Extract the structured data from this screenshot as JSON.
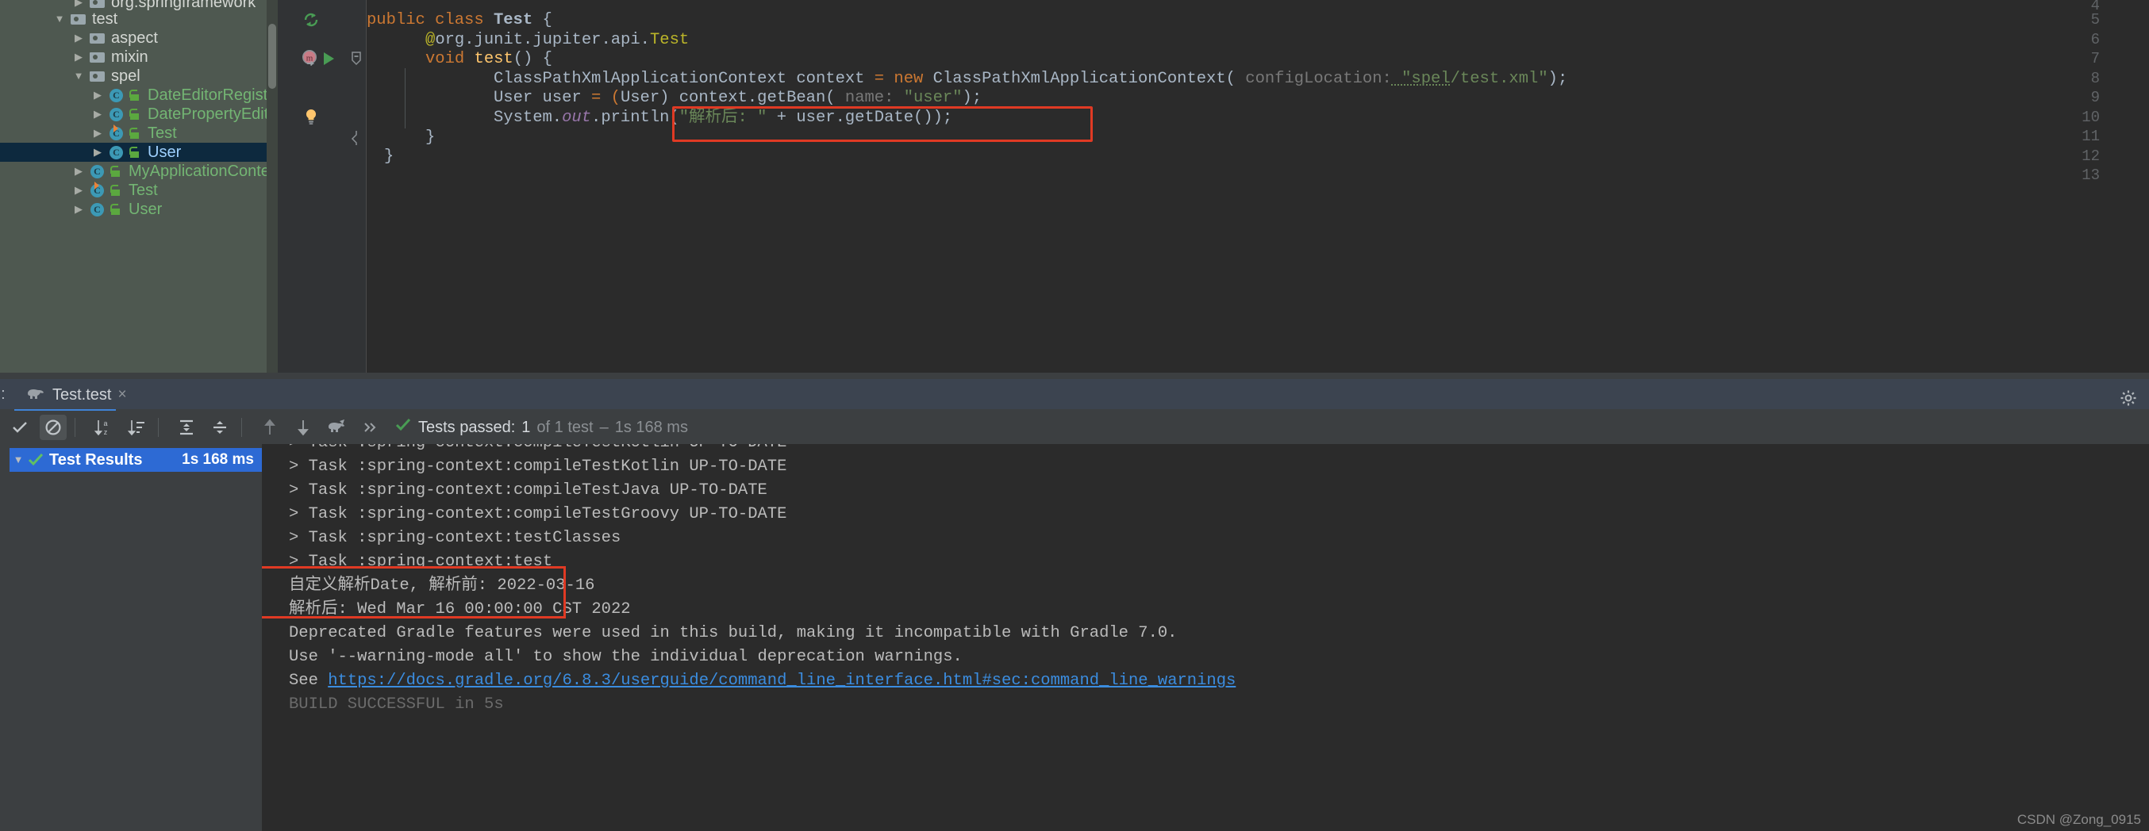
{
  "project_tree": {
    "items": [
      {
        "indent": 1,
        "arrow": "collapsed",
        "icon": "folder-icon",
        "label": "org.springframework",
        "kind": "pkg",
        "clipped_top": true
      },
      {
        "indent": 1,
        "arrow": "expanded",
        "icon": "folder-icon",
        "label": "test",
        "kind": "pkg"
      },
      {
        "indent": 2,
        "arrow": "collapsed",
        "icon": "folder-icon",
        "label": "aspect",
        "kind": "pkg"
      },
      {
        "indent": 2,
        "arrow": "collapsed",
        "icon": "folder-icon",
        "label": "mixin",
        "kind": "pkg"
      },
      {
        "indent": 2,
        "arrow": "expanded",
        "icon": "folder-icon",
        "label": "spel",
        "kind": "pkg"
      },
      {
        "indent": 3,
        "arrow": "collapsed",
        "icon": "java-class-icon",
        "lock": true,
        "label": "DateEditorRegister",
        "kind": "cls"
      },
      {
        "indent": 3,
        "arrow": "collapsed",
        "icon": "java-class-icon",
        "lock": true,
        "label": "DatePropertyEditor",
        "kind": "cls"
      },
      {
        "indent": 3,
        "arrow": "collapsed",
        "icon": "java-test-class-icon",
        "lock": true,
        "label": "Test",
        "kind": "cls"
      },
      {
        "indent": 3,
        "arrow": "collapsed",
        "icon": "java-class-icon",
        "lock": true,
        "label": "User",
        "kind": "cls",
        "selected": true
      },
      {
        "indent": 2,
        "arrow": "collapsed",
        "icon": "java-class-icon",
        "lock": true,
        "label": "MyApplicationContext",
        "kind": "cls"
      },
      {
        "indent": 2,
        "arrow": "collapsed",
        "icon": "java-test-class-icon",
        "lock": true,
        "label": "Test",
        "kind": "cls"
      },
      {
        "indent": 2,
        "arrow": "collapsed",
        "icon": "java-class-icon",
        "lock": true,
        "label": "User",
        "kind": "cls"
      }
    ]
  },
  "editor": {
    "line_numbers": [
      "4",
      "5",
      "6",
      "7",
      "8",
      "9",
      "10",
      "11",
      "12",
      "13"
    ],
    "gutter_markers": {
      "line5": "recompile-icon",
      "line7_junit": "junit-method-icon",
      "line7_run": "run-test-icon",
      "line7_fold": "fold-collapse-icon",
      "line10": "intention-bulb-icon",
      "line11_fold": "fold-brace-icon"
    },
    "code": {
      "l5_public": "public",
      "l5_class": "class",
      "l5_name": "Test",
      "l5_brace": "{",
      "l6_anno_at": "@org.junit.jupiter.api.",
      "l6_anno_name": "Test",
      "l7_void": "void",
      "l7_name": "test",
      "l7_rest": "() {",
      "l8_type": "ClassPathXmlApplicationContext",
      "l8_var": " context ",
      "l8_eq": "= ",
      "l8_new": "new",
      "l8_ctor": " ClassPathXmlApplicationContext(",
      "l8_hint": " configLocation:",
      "l8_str_a": " \"spel",
      "l8_str_b": "/test.xml\"",
      "l8_tail": ");",
      "l9_type": "User user ",
      "l9_eq": "= (",
      "l9_cast": "User",
      "l9_call": ") context.getBean(",
      "l9_hint": " name:",
      "l9_str": " \"user\"",
      "l9_tail": ");",
      "l10_sys": "System.",
      "l10_out": "out",
      "l10_println": ".println(",
      "l10_str": "\"解析后: \"",
      "l10_concat": " + user.getDate());",
      "l11_brace": "}",
      "l12_brace": "}"
    },
    "highlight_box_color": "#e03a24"
  },
  "run_window": {
    "label": "n:",
    "tab": {
      "icon": "gradle-elephant-icon",
      "title": "Test.test",
      "close": "×"
    },
    "gear": "settings-gear-icon",
    "toolbar": {
      "buttons": [
        {
          "name": "show-passed-tests-button",
          "icon": "check-icon",
          "active": false
        },
        {
          "name": "hide-ignored-tests-button",
          "icon": "circle-slash-icon",
          "active": true
        },
        {
          "name": "sort-alphabetically-button",
          "icon": "sort-alpha-icon",
          "active": false
        },
        {
          "name": "sort-by-duration-button",
          "icon": "sort-duration-icon",
          "active": false
        },
        {
          "name": "expand-all-button",
          "icon": "expand-all-icon",
          "active": false
        },
        {
          "name": "collapse-all-button",
          "icon": "collapse-all-icon",
          "active": false
        },
        {
          "name": "previous-failed-test-button",
          "icon": "arrow-up-icon",
          "active": false
        },
        {
          "name": "next-failed-test-button",
          "icon": "arrow-down-icon",
          "active": false
        },
        {
          "name": "rerun-gradle-button",
          "icon": "gradle-rerun-icon",
          "active": false
        },
        {
          "name": "more-options-button",
          "icon": "chevron-double-right-icon",
          "active": false
        }
      ],
      "status_icon": "check-green-icon",
      "status_prefix": "Tests passed:",
      "status_count": "1",
      "status_suffix": "of 1 test",
      "status_dash": "–",
      "status_time": "1s 168 ms"
    },
    "test_tree": {
      "root": {
        "arrow": "expanded",
        "icon": "check-green-icon",
        "label": "Test Results",
        "time": "1s 168 ms"
      }
    },
    "console": {
      "lines": [
        {
          "text": "> Task :spring-context:compileTestKotlin UP-TO-DATE",
          "style": "normal"
        },
        {
          "text": "> Task :spring-context:compileTestJava UP-TO-DATE",
          "style": "normal"
        },
        {
          "text": "> Task :spring-context:compileTestGroovy UP-TO-DATE",
          "style": "normal"
        },
        {
          "text": "> Task :spring-context:testClasses",
          "style": "normal"
        },
        {
          "text": "> Task :spring-context:test",
          "style": "normal"
        },
        {
          "text": "自定义解析Date, 解析前: 2022-03-16",
          "style": "normal"
        },
        {
          "text": "解析后: Wed Mar 16 00:00:00 CST 2022",
          "style": "normal"
        },
        {
          "text": "Deprecated Gradle features were used in this build, making it incompatible with Gradle 7.0.",
          "style": "normal"
        },
        {
          "text": "Use '--warning-mode all' to show the individual deprecation warnings.",
          "style": "normal"
        },
        {
          "text": "See ",
          "style": "normal",
          "link": "https://docs.gradle.org/6.8.3/userguide/command_line_interface.html#sec:command_line_warnings"
        },
        {
          "text": "BUILD SUCCESSFUL in 5s",
          "style": "clipped"
        }
      ],
      "highlight_box_color": "#e03a24"
    }
  },
  "watermark": "CSDN @Zong_0915"
}
